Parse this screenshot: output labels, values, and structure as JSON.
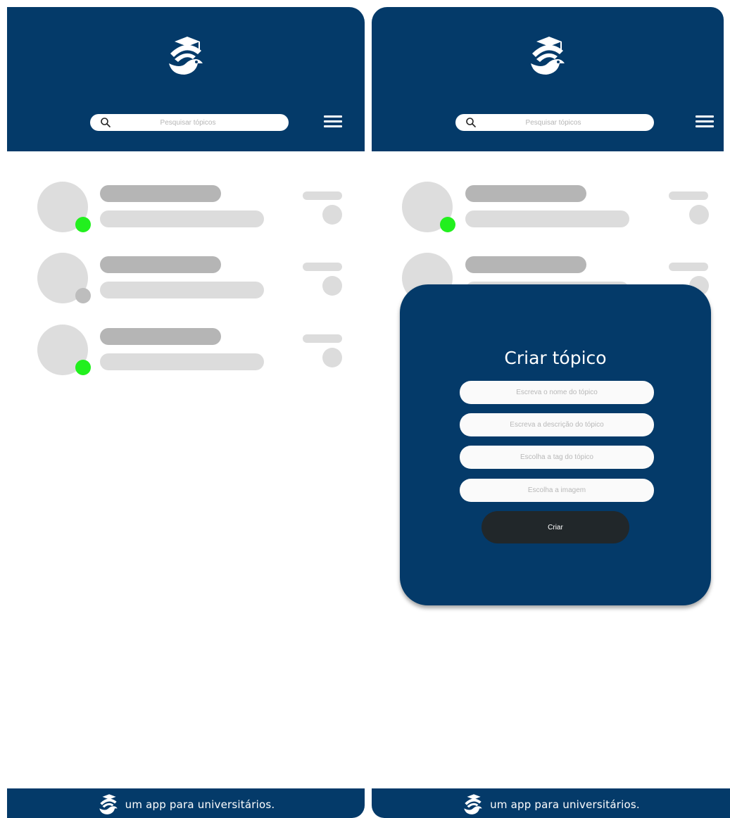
{
  "colors": {
    "brand": "#043a69",
    "online": "#22f01e",
    "offline": "#bdbdbd",
    "button": "#21272a"
  },
  "header": {
    "search_placeholder": "Pesquisar tópicos",
    "logo_icon": "graduation-bird-icon",
    "menu_icon": "hamburger-menu-icon"
  },
  "topics": [
    {
      "status": "online"
    },
    {
      "status": "offline"
    },
    {
      "status": "online"
    }
  ],
  "modal": {
    "title": "Criar tópico",
    "name_placeholder": "Escreva o nome do tópico",
    "description_placeholder": "Escreva a descrição do tópico",
    "tag_placeholder": "Escolha a tag do tópico",
    "image_placeholder": "Escolha a imagem",
    "create_label": "Criar"
  },
  "footer": {
    "tagline": "um app para universitários."
  }
}
